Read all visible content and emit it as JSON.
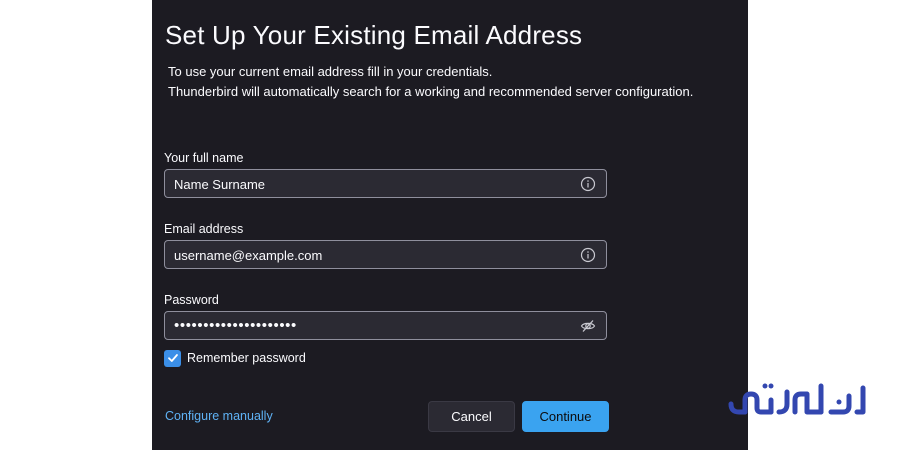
{
  "dialog": {
    "title": "Set Up Your Existing Email Address",
    "description_line1": "To use your current email address fill in your credentials.",
    "description_line2": "Thunderbird will automatically search for a working and recommended server configuration."
  },
  "fields": {
    "full_name": {
      "label": "Your full name",
      "value": "Name Surname"
    },
    "email": {
      "label": "Email address",
      "value": "username@example.com"
    },
    "password": {
      "label": "Password",
      "value": "•••••••••••••••••••••"
    }
  },
  "remember_password": {
    "label": "Remember password",
    "checked": true
  },
  "actions": {
    "configure_manually": "Configure manually",
    "cancel": "Cancel",
    "continue": "Continue"
  },
  "watermark": {
    "text": "ایران سرور",
    "color": "#3347b0"
  },
  "colors": {
    "accent": "#3aa3f0",
    "link": "#5fb2f5",
    "background": "#1c1b22",
    "field_bg": "#2b2a33"
  },
  "icons": {
    "info": "info-icon",
    "password_toggle": "eye-slash-icon",
    "check": "checkmark-icon"
  }
}
